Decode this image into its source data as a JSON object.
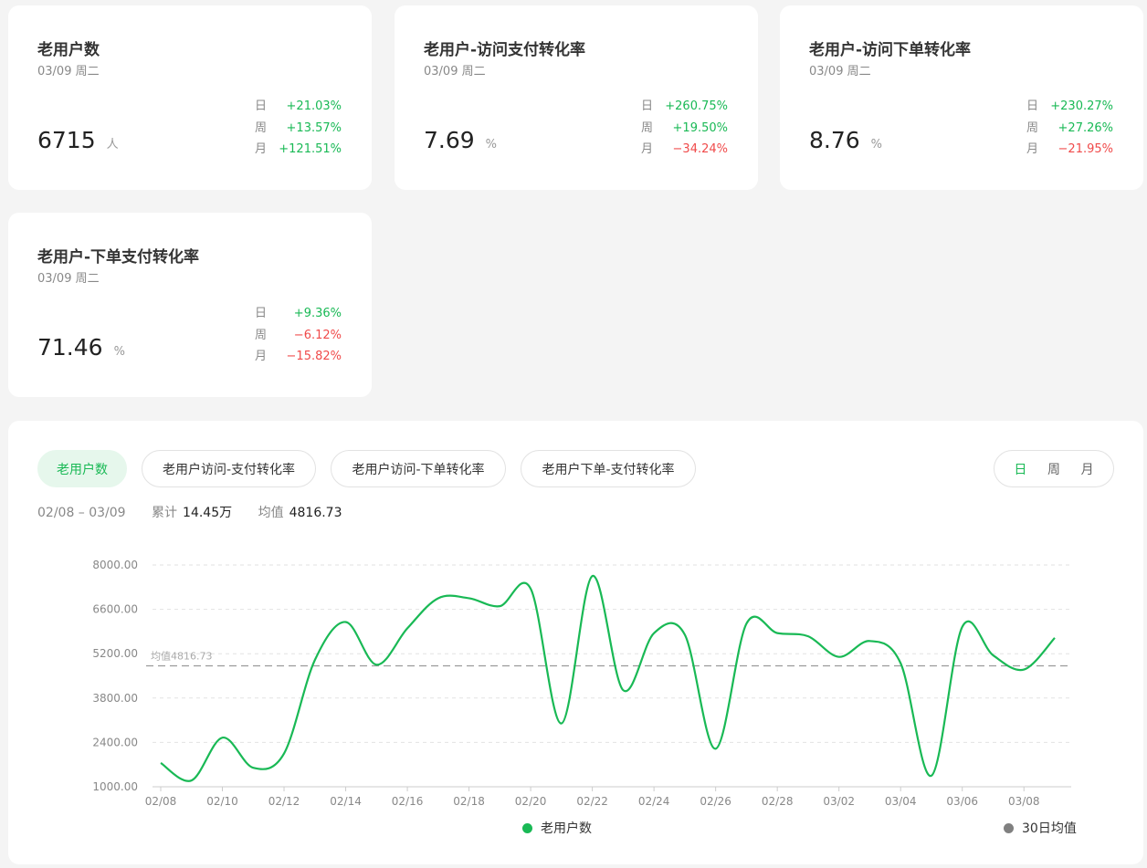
{
  "cards": [
    {
      "title": "老用户数",
      "date": "03/09 周二",
      "value": "6715",
      "unit": "人",
      "changes": [
        {
          "label": "日",
          "value": "+21.03%",
          "trend": "up"
        },
        {
          "label": "周",
          "value": "+13.57%",
          "trend": "up"
        },
        {
          "label": "月",
          "value": "+121.51%",
          "trend": "up"
        }
      ]
    },
    {
      "title": "老用户-访问支付转化率",
      "date": "03/09 周二",
      "value": "7.69",
      "unit": "%",
      "changes": [
        {
          "label": "日",
          "value": "+260.75%",
          "trend": "up"
        },
        {
          "label": "周",
          "value": "+19.50%",
          "trend": "up"
        },
        {
          "label": "月",
          "value": "−34.24%",
          "trend": "down"
        }
      ]
    },
    {
      "title": "老用户-访问下单转化率",
      "date": "03/09 周二",
      "value": "8.76",
      "unit": "%",
      "changes": [
        {
          "label": "日",
          "value": "+230.27%",
          "trend": "up"
        },
        {
          "label": "周",
          "value": "+27.26%",
          "trend": "up"
        },
        {
          "label": "月",
          "value": "−21.95%",
          "trend": "down"
        }
      ]
    },
    {
      "title": "老用户-下单支付转化率",
      "date": "03/09 周二",
      "value": "71.46",
      "unit": "%",
      "changes": [
        {
          "label": "日",
          "value": "+9.36%",
          "trend": "up"
        },
        {
          "label": "周",
          "value": "−6.12%",
          "trend": "down"
        },
        {
          "label": "月",
          "value": "−15.82%",
          "trend": "down"
        }
      ]
    }
  ],
  "tabs": [
    "老用户数",
    "老用户访问-支付转化率",
    "老用户访问-下单转化率",
    "老用户下单-支付转化率"
  ],
  "period": [
    "日",
    "周",
    "月"
  ],
  "stats": {
    "range": "02/08 – 03/09",
    "total_label": "累计",
    "total_value": "14.45万",
    "avg_label": "均值",
    "avg_value": "4816.73"
  },
  "colors": {
    "accent": "#19b955",
    "up": "#19b955",
    "down": "#f04a4a",
    "avg_legend": "#808080"
  },
  "chart_data": {
    "type": "line",
    "x": [
      "02/08",
      "02/09",
      "02/10",
      "02/11",
      "02/12",
      "02/13",
      "02/14",
      "02/15",
      "02/16",
      "02/17",
      "02/18",
      "02/19",
      "02/20",
      "02/21",
      "02/22",
      "02/23",
      "02/24",
      "02/25",
      "02/26",
      "02/27",
      "02/28",
      "03/01",
      "03/02",
      "03/03",
      "03/04",
      "03/05",
      "03/06",
      "03/07",
      "03/08",
      "03/09"
    ],
    "x_tick_labels": [
      "02/08",
      "02/10",
      "02/12",
      "02/14",
      "02/16",
      "02/18",
      "02/20",
      "02/22",
      "02/24",
      "02/26",
      "02/28",
      "03/02",
      "03/04",
      "03/06",
      "03/08"
    ],
    "series": [
      {
        "name": "老用户数",
        "values": [
          1750,
          1200,
          2550,
          1600,
          2050,
          5000,
          6200,
          4850,
          6000,
          6950,
          6950,
          6700,
          7250,
          3000,
          7650,
          4050,
          5850,
          5800,
          2200,
          6150,
          5850,
          5750,
          5100,
          5600,
          4900,
          1350,
          6050,
          5150,
          4700,
          5700
        ]
      }
    ],
    "average": {
      "label": "均值4816.73",
      "value": 4816.73,
      "legend": "30日均值"
    },
    "ylim": [
      1000,
      8000
    ],
    "y_ticks": [
      "1000.00",
      "2400.00",
      "3800.00",
      "5200.00",
      "6600.00",
      "8000.00"
    ],
    "grid": true,
    "legend": "bottom"
  }
}
